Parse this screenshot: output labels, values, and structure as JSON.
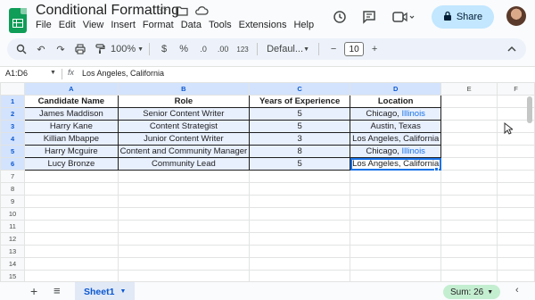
{
  "app": {
    "title": "Conditional Formatting",
    "menu": [
      "File",
      "Edit",
      "View",
      "Insert",
      "Format",
      "Data",
      "Tools",
      "Extensions",
      "Help"
    ],
    "share_label": "Share"
  },
  "toolbar": {
    "zoom": "100%",
    "currency": "$",
    "percent": "%",
    "dec_decrease": ".0",
    "dec_increase": ".00",
    "format_123": "123",
    "font": "Defaul...",
    "font_size": "10",
    "minus": "−",
    "plus": "+"
  },
  "formula_bar": {
    "name_box": "A1:D6",
    "fx_label": "fx",
    "content": "Los Angeles, California"
  },
  "grid": {
    "columns": [
      "A",
      "B",
      "C",
      "D",
      "E",
      "F"
    ],
    "rows": [
      "1",
      "2",
      "3",
      "4",
      "5",
      "6",
      "7",
      "8",
      "9",
      "10",
      "11",
      "12",
      "13",
      "14",
      "15",
      "16"
    ],
    "headers": [
      "Candidate Name",
      "Role",
      "Years of Experience",
      "Location"
    ],
    "data": [
      [
        "James Maddison",
        "Senior Content Writer",
        "5",
        "Chicago, ",
        "Illinois"
      ],
      [
        "Harry Kane",
        "Content Strategist",
        "5",
        "Austin, Texas",
        ""
      ],
      [
        "Killian Mbappe",
        "Junior Content Writer",
        "3",
        "Los Angeles, California",
        ""
      ],
      [
        "Harry Mcguire",
        "Content and Community Manager",
        "8",
        "Chicago, ",
        "Illinois"
      ],
      [
        "Lucy Bronze",
        "Community Lead",
        "5",
        "Los Angeles, California",
        ""
      ]
    ]
  },
  "bottom": {
    "add": "+",
    "list": "≡",
    "sheet_name": "Sheet1",
    "sum_label": "Sum: 26"
  },
  "colors": {
    "brand_green": "#0f9d58",
    "selection_blue": "#1a73e8",
    "share_bg": "#c2e7ff"
  }
}
